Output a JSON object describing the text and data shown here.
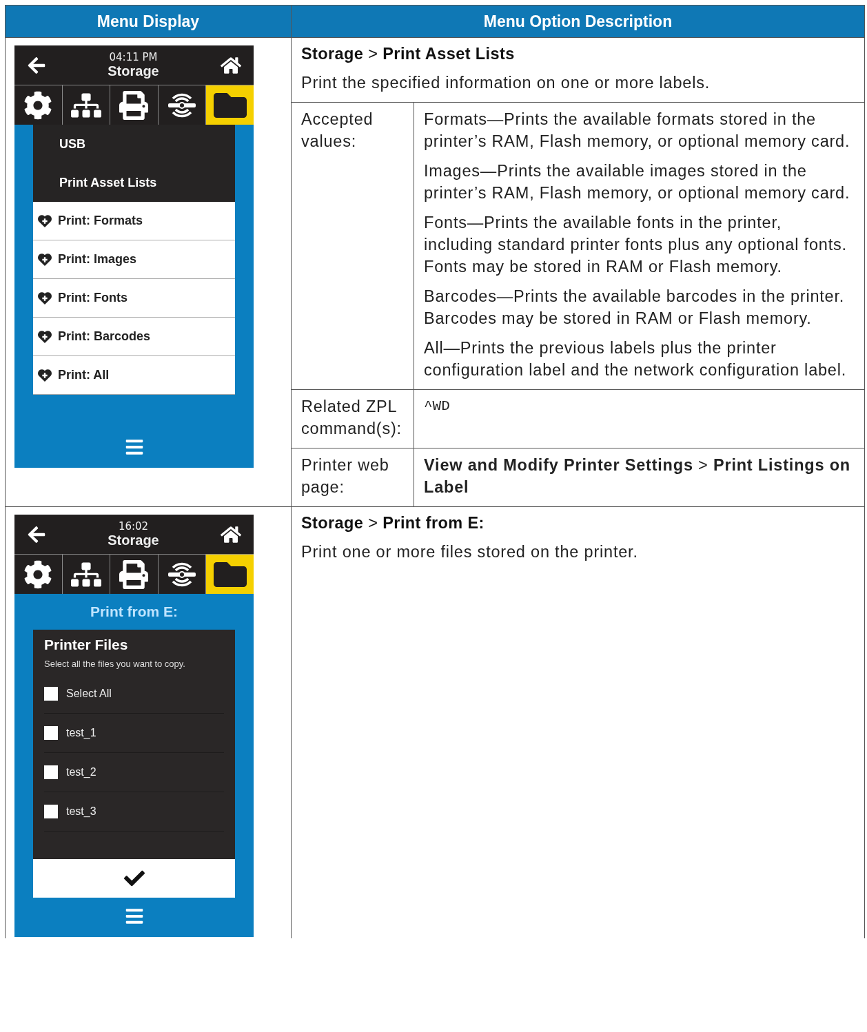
{
  "table": {
    "columns": [
      "Menu Display",
      "Menu Option Description"
    ],
    "rows": [
      {
        "screen": {
          "kind": "menu",
          "time": "04:11 PM",
          "title": "Storage",
          "tabs": [
            {
              "kind": "settings",
              "selected": false
            },
            {
              "kind": "network",
              "selected": false
            },
            {
              "kind": "print",
              "selected": false
            },
            {
              "kind": "wireless",
              "selected": false
            },
            {
              "kind": "storage",
              "selected": true
            }
          ],
          "items": [
            {
              "label": "USB",
              "kind": "header"
            },
            {
              "label": "Print Asset Lists",
              "kind": "header"
            },
            {
              "label": "Print: Formats",
              "kind": "favorite"
            },
            {
              "label": "Print: Images",
              "kind": "favorite"
            },
            {
              "label": "Print: Fonts",
              "kind": "favorite"
            },
            {
              "label": "Print: Barcodes",
              "kind": "favorite"
            },
            {
              "label": "Print: All",
              "kind": "favorite"
            }
          ]
        },
        "description": {
          "path": "**Storage** > **Print Asset Lists**",
          "summary": "Print the specified information on one or more labels.",
          "details": [
            {
              "label": "Accepted values:",
              "kind": "text",
              "values": [
                "Formats—Prints the available formats stored in the printer’s RAM, Flash memory, or optional memory card.",
                "Images—Prints the available images stored in the printer’s RAM, Flash memory, or optional memory card.",
                "Fonts—Prints the available fonts in the printer, including standard printer fonts plus any optional fonts. Fonts may be stored in RAM or Flash memory.",
                "Barcodes—Prints the available barcodes in the printer. Barcodes may be stored in RAM or Flash memory.",
                "All—Prints the previous labels plus the printer configuration label and the network configuration label."
              ]
            },
            {
              "label": "Related ZPL command(s):",
              "kind": "code",
              "values": [
                "^WD"
              ]
            },
            {
              "label": "Printer web page:",
              "kind": "text",
              "values": [
                "**View and Modify Printer Settings** > **Print Listings on Label**"
              ]
            }
          ]
        }
      },
      {
        "screen": {
          "kind": "files",
          "time": "16:02",
          "title": "Storage",
          "tabs": [
            {
              "kind": "settings",
              "selected": false
            },
            {
              "kind": "network",
              "selected": false
            },
            {
              "kind": "print",
              "selected": false
            },
            {
              "kind": "wireless",
              "selected": false
            },
            {
              "kind": "storage",
              "selected": true
            }
          ],
          "heading": "Print from E:",
          "panel_title": "Printer Files",
          "hint": "Select all the files you want to copy.",
          "files": [
            {
              "label": "Select All",
              "checked": false
            },
            {
              "label": "test_1",
              "checked": false
            },
            {
              "label": "test_2",
              "checked": false
            },
            {
              "label": "test_3",
              "checked": false
            }
          ]
        },
        "description": {
          "path": "**Storage** > **Print from E:**",
          "summary": "Print one or more files stored on the printer."
        }
      }
    ]
  }
}
